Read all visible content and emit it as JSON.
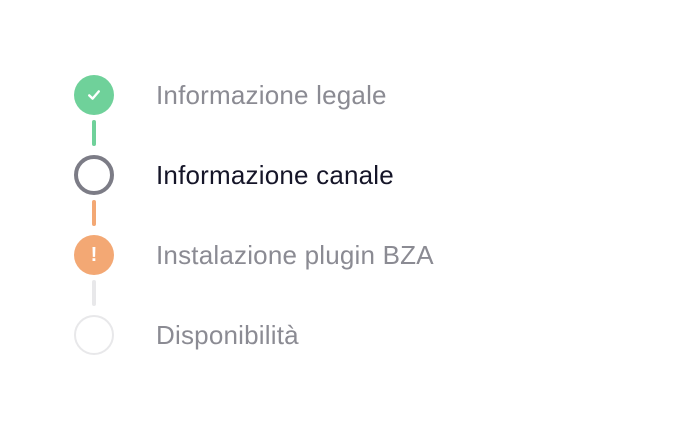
{
  "stepper": {
    "steps": [
      {
        "label": "Informazione legale",
        "status": "completed",
        "icon": "check-icon"
      },
      {
        "label": "Informazione canale",
        "status": "current",
        "icon": "ring-icon"
      },
      {
        "label": "Instalazione plugin BZA",
        "status": "warning",
        "icon": "exclamation-icon",
        "mark": "!"
      },
      {
        "label": "Disponibilità",
        "status": "pending",
        "icon": "empty-circle-icon"
      }
    ]
  },
  "colors": {
    "completed": "#6fd19a",
    "current": "#7c7c86",
    "warning": "#f3a874",
    "pending": "#e8e8ea",
    "label_muted": "#8b8b93",
    "label_active": "#151528"
  }
}
